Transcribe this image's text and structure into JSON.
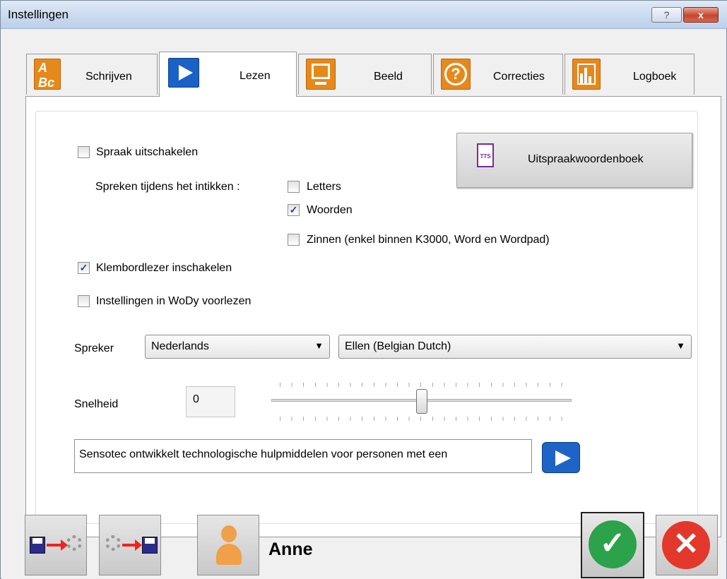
{
  "window": {
    "title": "Instellingen",
    "help_glyph": "?",
    "close_glyph": "x"
  },
  "tabs": [
    {
      "label": "Schrijven",
      "icon": "abc-icon",
      "icon_text": "A Bc",
      "active": false
    },
    {
      "label": "Lezen",
      "icon": "play-icon",
      "active": true
    },
    {
      "label": "Beeld",
      "icon": "monitor-icon",
      "active": false
    },
    {
      "label": "Correcties",
      "icon": "question-icon",
      "icon_text": "?",
      "active": false
    },
    {
      "label": "Logboek",
      "icon": "bar-chart-icon",
      "active": false
    }
  ],
  "options": {
    "spraak_uitschakelen": {
      "label": "Spraak uitschakelen",
      "checked": false
    },
    "spreken_label": "Spreken tijdens het intikken :",
    "letters": {
      "label": "Letters",
      "checked": false
    },
    "woorden": {
      "label": "Woorden",
      "checked": true
    },
    "zinnen": {
      "label": "Zinnen (enkel binnen K3000, Word en Wordpad)",
      "checked": false
    },
    "klembordlezer": {
      "label": "Klembordlezer inschakelen",
      "checked": true
    },
    "wody": {
      "label": "Instellingen in WoDy voorlezen",
      "checked": false
    }
  },
  "uitspraak_button": {
    "label": "Uitspraakwoordenboek",
    "icon_text": "TTS"
  },
  "spreker": {
    "label": "Spreker",
    "language": "Nederlands",
    "voice": "Ellen (Belgian Dutch)"
  },
  "snelheid": {
    "label": "Snelheid",
    "value": "0",
    "slider_fraction": 0.5
  },
  "sample_text": "Sensotec ontwikkelt technologische hulpmiddelen voor personen met een",
  "footer": {
    "user_name": "Anne"
  },
  "colors": {
    "accent_orange": "#e7891a",
    "accent_blue": "#1a62c6",
    "ok_green": "#2ca24a",
    "cancel_red": "#e4372c"
  }
}
